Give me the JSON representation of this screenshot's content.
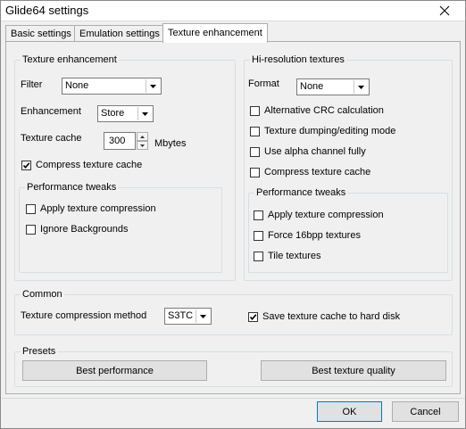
{
  "window": {
    "title": "Glide64 settings"
  },
  "tabs": [
    {
      "label": "Basic settings",
      "active": false
    },
    {
      "label": "Emulation settings",
      "active": false
    },
    {
      "label": "Texture enhancement",
      "active": true
    }
  ],
  "texture_enhancement": {
    "legend": "Texture enhancement",
    "filter_label": "Filter",
    "filter_value": "None",
    "enhancement_label": "Enhancement",
    "enhancement_value": "Store",
    "cache_label": "Texture cache",
    "cache_value": "300",
    "cache_unit": "Mbytes",
    "compress_cache": {
      "label": "Compress texture cache",
      "checked": true
    },
    "tweaks": {
      "legend": "Performance tweaks",
      "apply_compression": {
        "label": "Apply texture compression",
        "checked": false
      },
      "ignore_backgrounds": {
        "label": "Ignore Backgrounds",
        "checked": false
      }
    }
  },
  "hires": {
    "legend": "Hi-resolution textures",
    "format_label": "Format",
    "format_value": "None",
    "alt_crc": {
      "label": "Alternative CRC calculation",
      "checked": false
    },
    "dump_edit": {
      "label": "Texture dumping/editing mode",
      "checked": false
    },
    "alpha_full": {
      "label": "Use alpha channel fully",
      "checked": false
    },
    "compress_cache": {
      "label": "Compress texture cache",
      "checked": false
    },
    "tweaks": {
      "legend": "Performance tweaks",
      "apply_compression": {
        "label": "Apply texture compression",
        "checked": false
      },
      "force_16bpp": {
        "label": "Force 16bpp textures",
        "checked": false
      },
      "tile": {
        "label": "Tile textures",
        "checked": false
      }
    }
  },
  "common": {
    "legend": "Common",
    "method_label": "Texture compression method",
    "method_value": "S3TC",
    "save_cache": {
      "label": "Save texture cache to hard disk",
      "checked": true
    }
  },
  "presets": {
    "legend": "Presets",
    "best_performance": "Best performance",
    "best_quality": "Best texture quality"
  },
  "footer": {
    "ok": "OK",
    "cancel": "Cancel"
  }
}
